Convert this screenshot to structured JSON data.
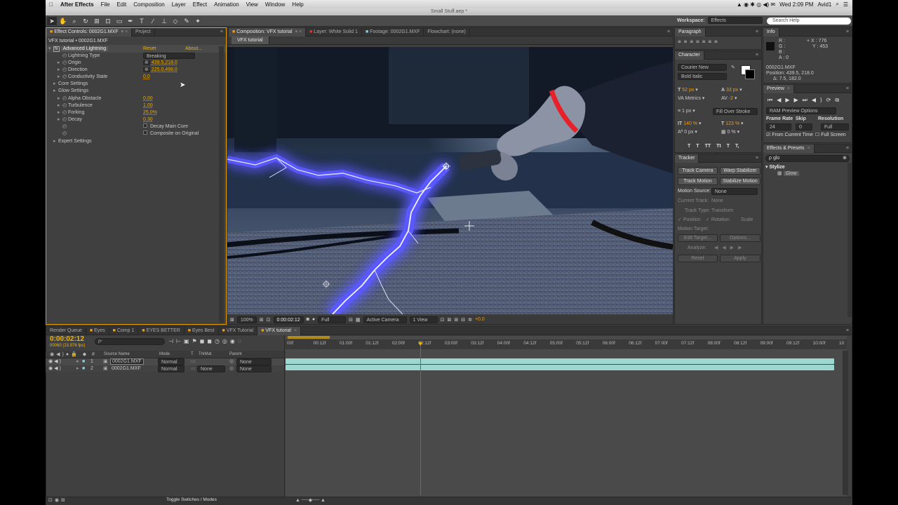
{
  "menubar": {
    "app": "After Effects",
    "items": [
      "File",
      "Edit",
      "Composition",
      "Layer",
      "Effect",
      "Animation",
      "View",
      "Window",
      "Help"
    ],
    "clock": "Wed 2:09 PM",
    "user": "Avid1"
  },
  "window_title": "Small Stuff.aep *",
  "toolbar": {
    "workspace_label": "Workspace:",
    "workspace_value": "Effects",
    "search_placeholder": "Search Help"
  },
  "effect_controls": {
    "tab": "Effect Controls: 0002G1.MXF",
    "tab2": "Project",
    "breadcrumb": "VFX tutorial • 0002G1.MXF",
    "fx_name": "Advanced Lightning",
    "reset": "Reset",
    "about": "About...",
    "props": [
      {
        "label": "Lightning Type",
        "value": "Breaking",
        "kind": "dropdown"
      },
      {
        "label": "Origin",
        "value": "439.5,218.0",
        "kind": "point"
      },
      {
        "label": "Direction",
        "value": "225.0,498.0",
        "kind": "point"
      },
      {
        "label": "Conductivity State",
        "value": "0.0",
        "kind": "num"
      },
      {
        "label": "Core Settings",
        "value": "",
        "kind": "group"
      },
      {
        "label": "Glow Settings",
        "value": "",
        "kind": "group"
      },
      {
        "label": "Alpha Obstacle",
        "value": "0.00",
        "kind": "num"
      },
      {
        "label": "Turbulence",
        "value": "1.00",
        "kind": "num"
      },
      {
        "label": "Forking",
        "value": "25.0%",
        "kind": "num"
      },
      {
        "label": "Decay",
        "value": "0.30",
        "kind": "num"
      },
      {
        "label": "",
        "value": "Decay Main Core",
        "kind": "check"
      },
      {
        "label": "",
        "value": "Composite on Original",
        "kind": "check"
      },
      {
        "label": "Expert Settings",
        "value": "",
        "kind": "group"
      }
    ]
  },
  "composition": {
    "tab": "Composition: VFX tutorial",
    "layer_tab": "Layer: White Solid 1",
    "footage_tab": "Footage: 0002G1.MXF",
    "flowchart_tab": "Flowchart: (none)",
    "subtab": "VFX tutorial",
    "zoom": "100%",
    "timecode": "0:00:02:12",
    "resolution": "Full",
    "camera": "Active Camera",
    "view": "1 View",
    "exposure": "+0.0"
  },
  "paragraph": {
    "tab": "Paragraph"
  },
  "character": {
    "tab": "Character",
    "font": "Courier New",
    "style": "Bold Italic",
    "size": "52 px",
    "leading": "33 px",
    "kerning": "Metrics",
    "tracking": "-2",
    "stroke": "1 px",
    "stroke_type": "Fill Over Stroke",
    "vscale": "140 %",
    "hscale": "123 %",
    "baseline": "0 px",
    "tsume": "0 %",
    "styles": [
      "T",
      "T",
      "TT",
      "Tt",
      "T",
      "T,"
    ]
  },
  "tracker": {
    "tab": "Tracker",
    "track_camera": "Track Camera",
    "warp_stabilizer": "Warp Stabilizer",
    "track_motion": "Track Motion",
    "stabilize_motion": "Stabilize Motion",
    "motion_source_label": "Motion Source:",
    "motion_source": "None",
    "current_track_label": "Current Track:",
    "current_track": "None",
    "track_type_label": "Track Type:",
    "track_type": "Transform",
    "position": "Position",
    "rotation": "Rotation",
    "scale": "Scale",
    "motion_target": "Motion Target:",
    "edit_target": "Edit Target...",
    "options": "Options...",
    "analyze": "Analyze:",
    "reset": "Reset",
    "apply": "Apply"
  },
  "info": {
    "tab": "Info",
    "r": "R :",
    "g": "G :",
    "b": "B :",
    "a": "A : 0",
    "x": "X : 776",
    "y": "Y : 453",
    "layer": "0002G1.MXF",
    "position": "Position: 439.5, 218.0",
    "delta": "Δ: 7.5, 182.0"
  },
  "preview": {
    "tab": "Preview",
    "ram": "RAM Preview Options",
    "frame_rate_label": "Frame Rate",
    "skip_label": "Skip",
    "resolution_label": "Resolution",
    "frame_rate": "24",
    "skip": "0",
    "resolution": "Full",
    "from_current": "From Current Time",
    "full_screen": "Full Screen"
  },
  "effects_presets": {
    "tab": "Effects & Presets",
    "search": "glo",
    "category": "Stylize",
    "item": "Glow"
  },
  "timeline": {
    "tabs": [
      "Render Queue",
      "Eyes",
      "Comp 1",
      "EYES BETTER",
      "Eyes Best",
      "VFX Tutorial",
      "VFX tutorial"
    ],
    "timecode": "0:00:02:12",
    "frame_info": "00060 (23.976 fps)",
    "search": "ρ-",
    "col_source": "Source Name",
    "col_mode": "Mode",
    "col_t": "T",
    "col_trkmat": "TrkMat",
    "col_parent": "Parent",
    "layers": [
      {
        "num": "1",
        "name": "0002G1.MXF",
        "mode": "Normal",
        "trkmat": "",
        "parent": "None"
      },
      {
        "num": "2",
        "name": "0002G1.MXF",
        "mode": "Normal",
        "trkmat": "None",
        "parent": "None"
      }
    ],
    "ruler": [
      "00f",
      "00:12f",
      "01:00f",
      "01:12f",
      "02:00f",
      "02:12f",
      "03:00f",
      "03:12f",
      "04:00f",
      "04:12f",
      "05:00f",
      "05:12f",
      "06:00f",
      "06:12f",
      "07:00f",
      "07:12f",
      "08:00f",
      "08:12f",
      "09:00f",
      "09:12f",
      "10:00f",
      "10"
    ],
    "playhead_fraction": 0.245,
    "toggle": "Toggle Switches / Modes"
  },
  "colors": {
    "accent": "#f59b00",
    "playhead": "#e03a2a",
    "track_bar": "#9ed7d0",
    "lightning": "#5a58ff"
  }
}
